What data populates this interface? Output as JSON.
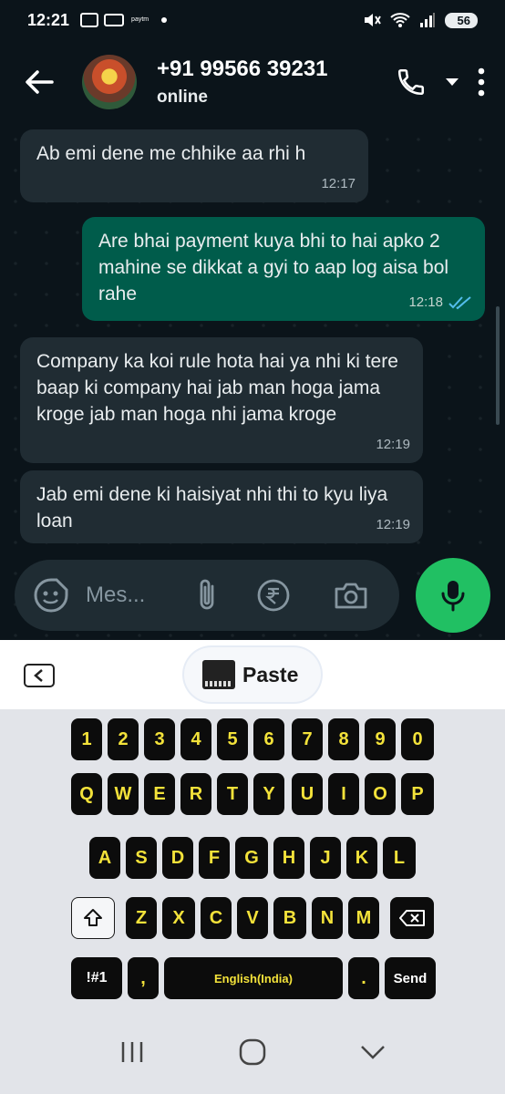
{
  "status_bar": {
    "time": "12:21",
    "paytm_text": "paytm",
    "battery": "56"
  },
  "header": {
    "contact_name": "+91 99566 39231",
    "contact_status": "online"
  },
  "messages": [
    {
      "direction": "in",
      "text": "Ab emi dene me chhike aa rhi h",
      "time": "12:17"
    },
    {
      "direction": "out",
      "text": "Are bhai payment kuya bhi to hai apko 2 mahine se dikkat a gyi to aap log aisa bol rahe",
      "time": "12:18",
      "read": true
    },
    {
      "direction": "in",
      "text": "Company ka koi rule hota hai ya nhi ki tere baap ki company hai jab man hoga jama kroge jab man hoga nhi jama kroge",
      "time": "12:19"
    },
    {
      "direction": "in",
      "text": "Jab emi dene ki haisiyat nhi thi to kyu liya loan",
      "time": "12:19"
    }
  ],
  "composer": {
    "placeholder": "Mes..."
  },
  "keyboard_toolbar": {
    "paste_label": "Paste"
  },
  "keyboard": {
    "row_numbers": [
      "1",
      "2",
      "3",
      "4",
      "5",
      "6",
      "7",
      "8",
      "9",
      "0"
    ],
    "row_1": [
      "Q",
      "W",
      "E",
      "R",
      "T",
      "Y",
      "U",
      "I",
      "O",
      "P"
    ],
    "row_2": [
      "A",
      "S",
      "D",
      "F",
      "G",
      "H",
      "J",
      "K",
      "L"
    ],
    "row_3": [
      "Z",
      "X",
      "C",
      "V",
      "B",
      "N",
      "M"
    ],
    "symbols_label": "!#1",
    "comma_label": ",",
    "space_label": "English(India)",
    "period_label": ".",
    "send_label": "Send"
  },
  "colors": {
    "app_background": "#0b141a",
    "incoming_bubble": "#202c33",
    "outgoing_bubble": "#005c4b",
    "accent_green": "#21c063",
    "key_text": "#f3e23a",
    "read_ticks": "#53bdeb"
  },
  "icons": [
    "back-arrow-icon",
    "phone-icon",
    "dropdown-icon",
    "more-options-icon",
    "sticker-icon",
    "attach-icon",
    "rupee-icon",
    "camera-icon",
    "mic-icon",
    "shift-icon",
    "backspace-icon",
    "keyboard-back-icon",
    "recent-apps-icon",
    "home-icon",
    "nav-back-icon"
  ]
}
